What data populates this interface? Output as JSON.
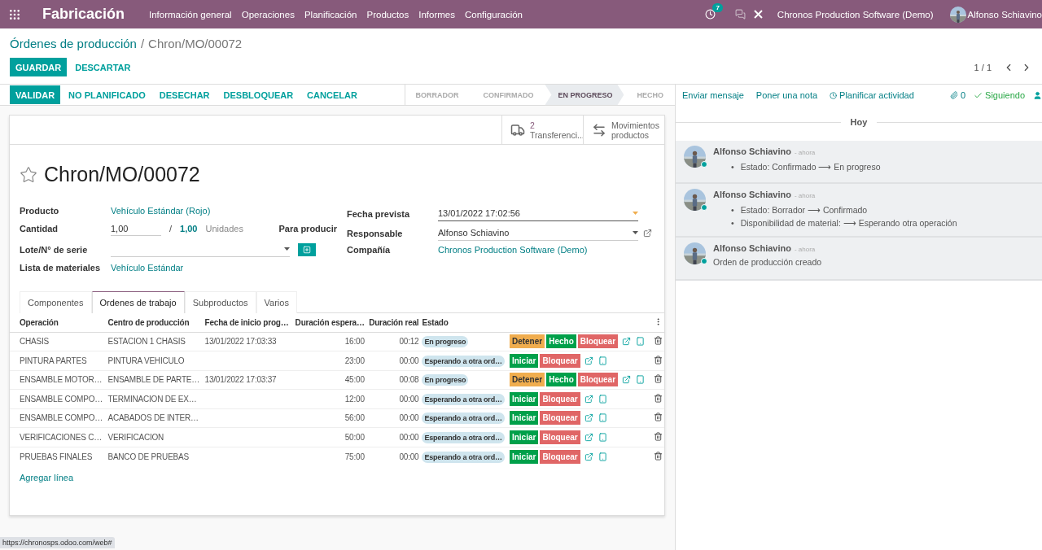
{
  "navbar": {
    "app": "Fabricación",
    "menu": [
      "Información general",
      "Operaciones",
      "Planificación",
      "Productos",
      "Informes",
      "Configuración"
    ],
    "activity_count": "7",
    "company": "Chronos Production Software (Demo)",
    "user": "Alfonso Schiavino"
  },
  "breadcrumb": {
    "parent": "Órdenes de producción",
    "separator": "/",
    "current": "Chron/MO/00072"
  },
  "form_buttons": [
    {
      "label": "GUARDAR",
      "kind": "primary"
    },
    {
      "label": "DESCARTAR",
      "kind": "link"
    }
  ],
  "pager": "1 / 1",
  "actions": [
    {
      "label": "VALIDAR",
      "kind": "primary"
    },
    {
      "label": "NO PLANIFICADO",
      "kind": "link"
    },
    {
      "label": "DESECHAR",
      "kind": "link"
    },
    {
      "label": "DESBLOQUEAR",
      "kind": "link"
    },
    {
      "label": "CANCELAR",
      "kind": "link"
    }
  ],
  "stages": [
    {
      "label": "BORRADOR",
      "selected": false
    },
    {
      "label": "CONFIRMADO",
      "selected": false
    },
    {
      "label": "EN PROGRESO",
      "selected": true
    },
    {
      "label": "HECHO",
      "selected": false
    }
  ],
  "smart_buttons": [
    {
      "kind": "truck",
      "value": "2",
      "label": "Transferenci..."
    },
    {
      "kind": "moves",
      "label": "Movimientos productos"
    }
  ],
  "record": {
    "title": "Chron/MO/00072",
    "favorite": false
  },
  "left_fields": {
    "product_label": "Producto",
    "product": "Vehículo Estándar (Rojo)",
    "qty_label": "Cantidad",
    "qty": "1,00",
    "qty_sep": "/",
    "qty_total": "1,00",
    "uom": "Unidades",
    "to_produce": "Para producir",
    "lot_label": "Lote/N° de serie",
    "bom_label": "Lista de materiales",
    "bom": "Vehículo Estándar"
  },
  "right_fields": {
    "date_label": "Fecha prevista",
    "date": "13/01/2022 17:02:56",
    "resp_label": "Responsable",
    "resp": "Alfonso Schiavino",
    "company_label": "Compañía",
    "company": "Chronos Production Software (Demo)"
  },
  "tabs": [
    {
      "label": "Componentes",
      "selected": false
    },
    {
      "label": "Ordenes de trabajo",
      "selected": true
    },
    {
      "label": "Subproductos",
      "selected": false
    },
    {
      "label": "Varios",
      "selected": false
    }
  ],
  "table": {
    "columns": [
      "Operación",
      "Centro de producción",
      "Fecha de inicio prog…",
      "Duración espera…",
      "Duración real",
      "Estado"
    ],
    "rows": [
      {
        "operation": "CHASIS",
        "center": "ESTACION 1 CHASIS",
        "start": "13/01/2022 17:03:33",
        "expected": "16:00",
        "real": "00:12",
        "status": "En progreso",
        "actions": [
          {
            "label": "Detener",
            "kind": "warning"
          },
          {
            "label": "Hecho",
            "kind": "success"
          },
          {
            "label": "Bloquear",
            "kind": "danger"
          }
        ]
      },
      {
        "operation": "PINTURA PARTES",
        "center": "PINTURA VEHICULO",
        "expected": "23:00",
        "real": "00:00",
        "status": "Esperando a otra ord…",
        "actions": [
          {
            "label": "Iniciar",
            "kind": "success"
          },
          {
            "label": "Bloquear",
            "kind": "danger"
          }
        ]
      },
      {
        "operation": "ENSAMBLE MOTOR…",
        "center": "ENSAMBLE DE PARTE…",
        "start": "13/01/2022 17:03:37",
        "expected": "45:00",
        "real": "00:08",
        "status": "En progreso",
        "actions": [
          {
            "label": "Detener",
            "kind": "warning"
          },
          {
            "label": "Hecho",
            "kind": "success"
          },
          {
            "label": "Bloquear",
            "kind": "danger"
          }
        ]
      },
      {
        "operation": "ENSAMBLE COMPO…",
        "center": "TERMINACION DE EX…",
        "expected": "12:00",
        "real": "00:00",
        "status": "Esperando a otra ord…",
        "actions": [
          {
            "label": "Iniciar",
            "kind": "success"
          },
          {
            "label": "Bloquear",
            "kind": "danger"
          }
        ]
      },
      {
        "operation": "ENSAMBLE COMPO…",
        "center": "ACABADOS DE INTER…",
        "expected": "56:00",
        "real": "00:00",
        "status": "Esperando a otra ord…",
        "actions": [
          {
            "label": "Iniciar",
            "kind": "success"
          },
          {
            "label": "Bloquear",
            "kind": "danger"
          }
        ]
      },
      {
        "operation": "VERIFICACIONES C…",
        "center": "VERIFICACION",
        "expected": "50:00",
        "real": "00:00",
        "status": "Esperando a otra ord…",
        "actions": [
          {
            "label": "Iniciar",
            "kind": "success"
          },
          {
            "label": "Bloquear",
            "kind": "danger"
          }
        ]
      },
      {
        "operation": "PRUEBAS FINALES",
        "center": "BANCO DE PRUEBAS",
        "expected": "75:00",
        "real": "00:00",
        "status": "Esperando a otra ord…",
        "actions": [
          {
            "label": "Iniciar",
            "kind": "success"
          },
          {
            "label": "Bloquear",
            "kind": "danger"
          }
        ]
      }
    ],
    "add_line": "Agregar línea"
  },
  "chatter": {
    "bullet": "•",
    "send": "Enviar mensaje",
    "note": "Poner una nota",
    "activity": "Planificar actividad",
    "attachments": "0",
    "following": "Siguiendo",
    "date_separator": "Hoy",
    "messages": [
      {
        "author": "Alfonso Schiavino",
        "time": "- ahora",
        "changes": [
          "Estado: Confirmado ⟶ En progreso"
        ]
      },
      {
        "author": "Alfonso Schiavino",
        "time": "- ahora",
        "changes": [
          "Estado: Borrador ⟶ Confirmado",
          "Disponibilidad de material: ⟶ Esperando otra operación"
        ]
      },
      {
        "author": "Alfonso Schiavino",
        "time": "- ahora",
        "body": "Orden de producción creado"
      }
    ]
  },
  "status_bar": "https://chronosps.odoo.com/web#"
}
